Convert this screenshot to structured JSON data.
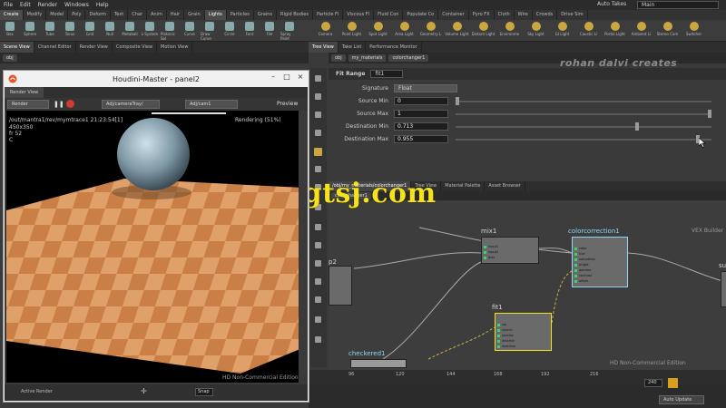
{
  "menubar": {
    "items": [
      "File",
      "Edit",
      "Render",
      "Windows",
      "Help"
    ],
    "auto_takes": "Auto Takes",
    "desktop": "Main"
  },
  "shelf": {
    "tabs": [
      "Create",
      "Modify",
      "Model",
      "Poly",
      "Deform",
      "Text",
      "Char",
      "Anim",
      "Hair",
      "Grain",
      "Lights",
      "Particles",
      "Grains",
      "Rigid Bodies",
      "Particle Fl",
      "Viscous Fl",
      "Fluid Con",
      "Populate Co",
      "Container",
      "Pyro FX",
      "Cloth",
      "Wire",
      "Crowds",
      "Drive Sim"
    ],
    "tools_left": [
      "Box",
      "Sphere",
      "Tube",
      "Torus",
      "Grid",
      "Null",
      "Metaball",
      "L-System",
      "Platonic Sol",
      "Curve",
      "Draw Curve",
      "Circle",
      "Font",
      "File",
      "Spray Paint"
    ],
    "tools_right": [
      "Camera",
      "Point Light",
      "Spot Light",
      "Area Light",
      "Geometry L",
      "Volume Light",
      "Distant Light",
      "Environme",
      "Sky Light",
      "GI Light",
      "Caustic Li",
      "Portal Light",
      "Ambient Li",
      "Stereo Cam",
      "Switcher"
    ]
  },
  "left_pane": {
    "tabs": [
      "Scene View",
      "Channel Editor",
      "Render View",
      "Composite View",
      "Motion View"
    ],
    "path": "obj"
  },
  "right_pane": {
    "tabs": [
      "Tree View",
      "Take List",
      "Performance Monitor"
    ],
    "path": [
      "obj",
      "my_materials",
      "colorchanger1"
    ]
  },
  "watermark_top": "rohan dalvi creates",
  "parameters": {
    "node_type": "Fit Range",
    "node_name": "fit1",
    "rows": [
      {
        "label": "Signature",
        "value": "Float",
        "kind": "select"
      },
      {
        "label": "Source Min",
        "value": "0",
        "kind": "slider",
        "fraction": 0.0
      },
      {
        "label": "Source Max",
        "value": "1",
        "kind": "slider",
        "fraction": 1.0
      },
      {
        "label": "Destination Min",
        "value": "0.713",
        "kind": "slider",
        "fraction": 0.713
      },
      {
        "label": "Destination Max",
        "value": "0.955",
        "kind": "slider",
        "fraction": 0.955
      }
    ]
  },
  "network": {
    "tabs": [
      "/obj/my_materials/colorchanger1",
      "Tree View",
      "Material Palette",
      "Asset Browser"
    ],
    "path": "colorchanger1",
    "nodes": {
      "mix": {
        "label": "mix1",
        "ports": [
          "input1",
          "input2",
          "bias"
        ]
      },
      "colorcorrection": {
        "label": "colorcorrection1",
        "ports": [
          "color",
          "hue",
          "saturation",
          "bright",
          "gamma",
          "contrast",
          "offset"
        ]
      },
      "fit": {
        "label": "fit1",
        "ports": [
          "val",
          "srcmin",
          "srcmax",
          "destmin",
          "destmax"
        ]
      },
      "checkered": {
        "label": "checkered1"
      },
      "noise": {
        "label": "p2"
      },
      "output": {
        "label": "su"
      }
    },
    "corner_label": "VEX Builder",
    "non_commercial": "HD Non-Commercial Edition"
  },
  "timeline": {
    "ticks": [
      "96",
      "120",
      "144",
      "168",
      "192",
      "216"
    ],
    "frame": "240",
    "auto_update": "Auto Update"
  },
  "render_window": {
    "title": "Houdini-Master - panel2",
    "pane_tab": "Render View",
    "render_button": "Render",
    "camera": "Adj/cameraTray/",
    "renderer": "Adj/cam1",
    "preview": "Preview",
    "path_info": "/out/mantra1/rev/mymtrace1",
    "time": "21:23:54[1]",
    "resolution": "450x350",
    "frame_info": "fr 52",
    "channel": "C",
    "status": "Rendering (51%)",
    "progress": 0.51,
    "non_commercial": "HD Non-Commercial Edition",
    "bottom_status": "Active Render",
    "zoom": "Snap"
  },
  "overlay_watermark": "www.cgtsj.com",
  "colors": {
    "accent_yellow": "#f5e21a",
    "node_cyan": "#8fd6f2",
    "port_green": "#3bd36c",
    "floor_wood": "#d6955a"
  }
}
